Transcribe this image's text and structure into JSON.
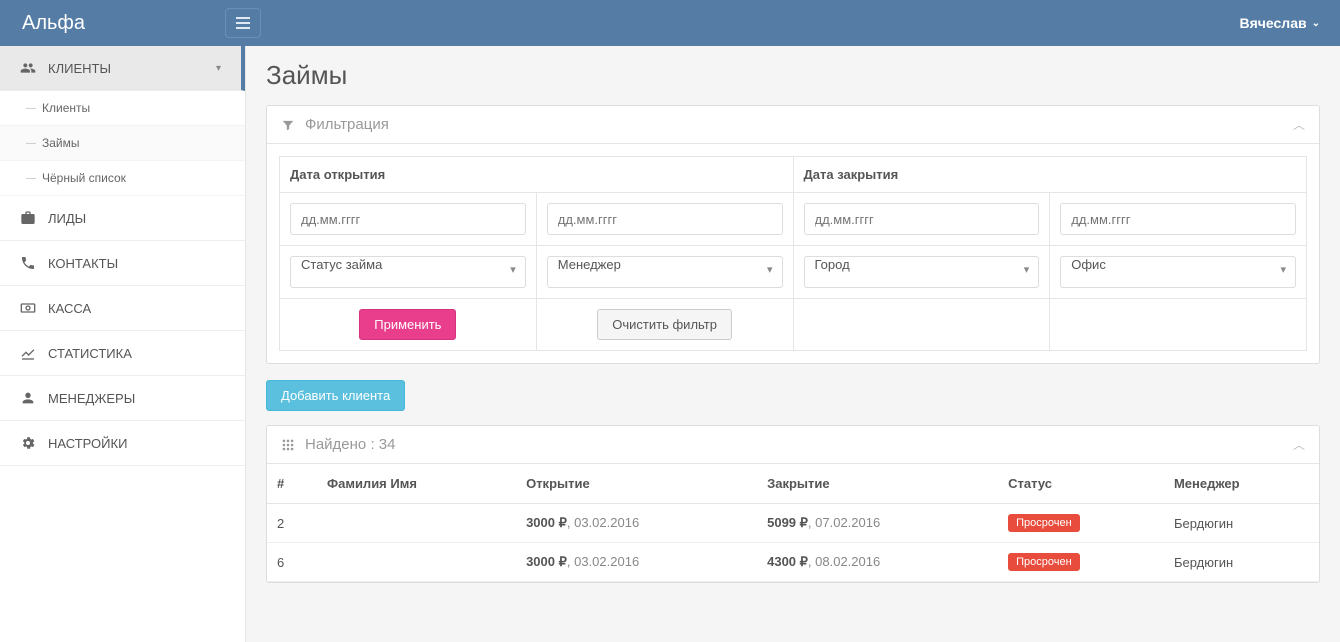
{
  "navbar": {
    "brand": "Альфа",
    "user": "Вячеслав"
  },
  "sidebar": {
    "items": [
      {
        "label": "КЛИЕНТЫ",
        "active": true,
        "children": [
          "Клиенты",
          "Займы",
          "Чёрный список"
        ]
      },
      {
        "label": "ЛИДЫ"
      },
      {
        "label": "КОНТАКТЫ"
      },
      {
        "label": "КАССА"
      },
      {
        "label": "СТАТИСТИКА"
      },
      {
        "label": "МЕНЕДЖЕРЫ"
      },
      {
        "label": "НАСТРОЙКИ"
      }
    ]
  },
  "page": {
    "title": "Займы"
  },
  "filter": {
    "title": "Фильтрация",
    "open_date_label": "Дата открытия",
    "close_date_label": "Дата закрытия",
    "date_placeholder": "дд.мм.гггг",
    "status_select": "Статус займа",
    "manager_select": "Менеджер",
    "city_select": "Город",
    "office_select": "Офис",
    "apply_btn": "Применить",
    "clear_btn": "Очистить фильтр"
  },
  "buttons": {
    "add_client": "Добавить клиента"
  },
  "results": {
    "found_label": "Найдено",
    "count": "34",
    "columns": {
      "num": "#",
      "name": "Фамилия Имя",
      "open": "Открытие",
      "close": "Закрытие",
      "status": "Статус",
      "manager": "Менеджер"
    },
    "status_overdue": "Просрочен",
    "rows": [
      {
        "num": "2",
        "name": "",
        "open_amount": "3000 ₽",
        "open_date": "03.02.2016",
        "close_amount": "5099 ₽",
        "close_date": "07.02.2016",
        "status": "overdue",
        "manager": "Бердюгин"
      },
      {
        "num": "6",
        "name": "",
        "open_amount": "3000 ₽",
        "open_date": "03.02.2016",
        "close_amount": "4300 ₽",
        "close_date": "08.02.2016",
        "status": "overdue",
        "manager": "Бердюгин"
      }
    ]
  }
}
